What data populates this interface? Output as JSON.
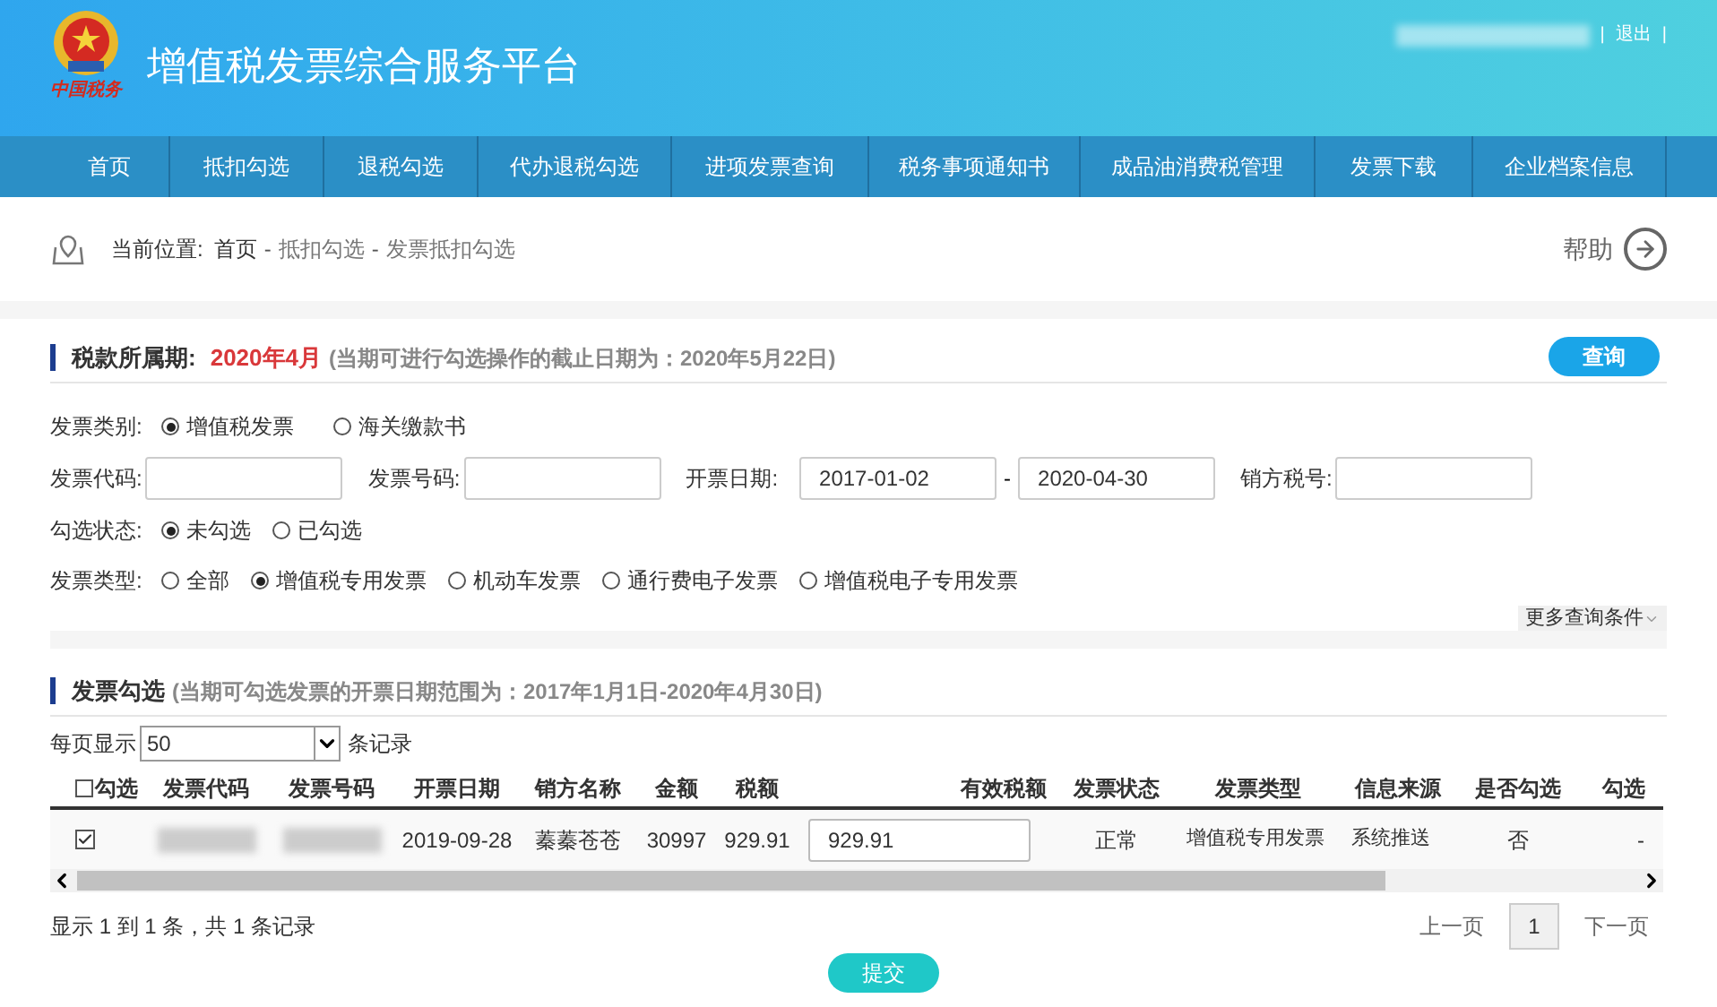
{
  "header": {
    "logo_text": "中国税务",
    "title": "增值税发票综合服务平台",
    "user_separator": "|",
    "logout": "退出",
    "end_separator": "|"
  },
  "nav": [
    "首页",
    "抵扣勾选",
    "退税勾选",
    "代办退税勾选",
    "进项发票查询",
    "税务事项通知书",
    "成品油消费税管理",
    "发票下载",
    "企业档案信息"
  ],
  "breadcrumb": {
    "label": "当前位置:",
    "items": [
      "首页",
      "抵扣勾选",
      "发票抵扣勾选"
    ],
    "separator": "-",
    "help": "帮助"
  },
  "period_section": {
    "title": "税款所属期:",
    "period": "2020年4月",
    "note": "(当期可进行勾选操作的截止日期为：2020年5月22日)",
    "query_button": "查询"
  },
  "filters": [
    {
      "kind": "radio",
      "label": "发票类别:",
      "options": [
        {
          "label": "增值税发票",
          "selected": true
        },
        {
          "label": "海关缴款书",
          "selected": false
        }
      ]
    },
    {
      "kind": "fields",
      "fields": [
        {
          "label": "发票代码:"
        },
        {
          "label": "发票号码:"
        },
        {
          "label": "开票日期:",
          "value": "2017-01-02",
          "range_to": "2020-04-30",
          "separator": "-"
        },
        {
          "label": "销方税号:"
        }
      ]
    },
    {
      "kind": "radio",
      "label": "勾选状态:",
      "options": [
        {
          "label": "未勾选",
          "selected": true
        },
        {
          "label": "已勾选",
          "selected": false
        }
      ]
    },
    {
      "kind": "radio",
      "label": "发票类型:",
      "options": [
        {
          "label": "全部",
          "selected": false
        },
        {
          "label": "增值税专用发票",
          "selected": true
        },
        {
          "label": "机动车发票",
          "selected": false
        },
        {
          "label": "通行费电子发票",
          "selected": false
        },
        {
          "label": "增值税电子专用发票",
          "selected": false
        }
      ]
    }
  ],
  "more_conditions": "更多查询条件",
  "invoice_section": {
    "title": "发票勾选",
    "note": "(当期可勾选发票的开票日期范围为：2017年1月1日-2020年4月30日)"
  },
  "page_size": {
    "prefix": "每页显示",
    "value": "50",
    "suffix": "条记录"
  },
  "table": {
    "select_all": {
      "label": "勾选",
      "checked": false
    },
    "columns": [
      "发票代码",
      "发票号码",
      "开票日期",
      "销方名称",
      "金额",
      "税额",
      "有效税额",
      "发票状态",
      "发票类型",
      "信息来源",
      "是否勾选",
      "勾选"
    ],
    "rows": [
      {
        "checked": true,
        "cells": [
          null,
          null,
          "2019-09-28",
          "蓁蓁苍苍",
          "30997",
          "929.91",
          "929.91",
          "正常",
          "增值税专用发票",
          "系统推送",
          "否",
          "-"
        ]
      }
    ]
  },
  "footer": {
    "summary": "显示 1 到 1 条，共 1 条记录",
    "prev": "上一页",
    "pages": [
      {
        "label": "1",
        "selected": true
      }
    ],
    "next": "下一页"
  },
  "submit": "提交"
}
